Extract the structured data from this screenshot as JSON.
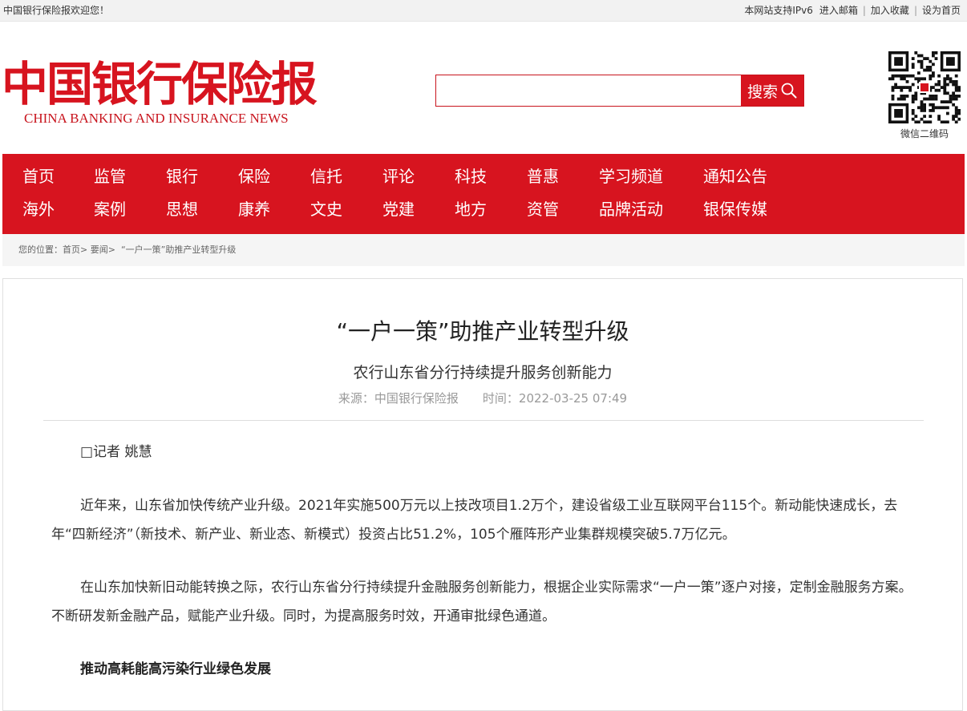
{
  "topbar": {
    "welcome": "中国银行保险报欢迎您！",
    "ipv6": "本网站支持IPv6",
    "mail": "进入邮箱",
    "favorite": "加入收藏",
    "homepage": "设为首页",
    "separator": "|"
  },
  "logo": {
    "cn": "中国银行保险报",
    "en": "CHINA BANKING AND INSURANCE NEWS"
  },
  "search": {
    "placeholder": "",
    "button_label": "搜索",
    "icon": "search-icon"
  },
  "qr": {
    "label": "微信二维码"
  },
  "nav": {
    "row1": [
      "首页",
      "监管",
      "银行",
      "保险",
      "信托",
      "评论",
      "科技",
      "普惠",
      "学习频道",
      "通知公告"
    ],
    "row2": [
      "海外",
      "案例",
      "思想",
      "康养",
      "文史",
      "党建",
      "地方",
      "资管",
      "品牌活动",
      "银保传媒"
    ]
  },
  "breadcrumb": {
    "prefix": "您的位置：",
    "home": "首页",
    "sep": ">",
    "section": "要闻",
    "current": "“一户一策”助推产业转型升级"
  },
  "article": {
    "title": "“一户一策”助推产业转型升级",
    "subtitle": "农行山东省分行持续提升服务创新能力",
    "source": "来源：中国银行保险报",
    "time": "时间：2022-03-25 07:49",
    "author": "□记者 姚慧",
    "p1": "近年来，山东省加快传统产业升级。2021年实施500万元以上技改项目1.2万个，建设省级工业互联网平台115个。新动能快速成长，去年“四新经济”（新技术、新产业、新业态、新模式）投资占比51.2%，105个雁阵形产业集群规模突破5.7万亿元。",
    "p2": "在山东加快新旧动能转换之际，农行山东省分行持续提升金融服务创新能力，根据企业实际需求“一户一策”逐户对接，定制金融服务方案。不断研发新金融产品，赋能产业升级。同时，为提高服务时效，开通审批绿色通道。",
    "heading1": "推动高耗能高污染行业绿色发展"
  },
  "colors": {
    "brand_red": "#d7141f",
    "text": "#333333",
    "muted": "#999999"
  }
}
